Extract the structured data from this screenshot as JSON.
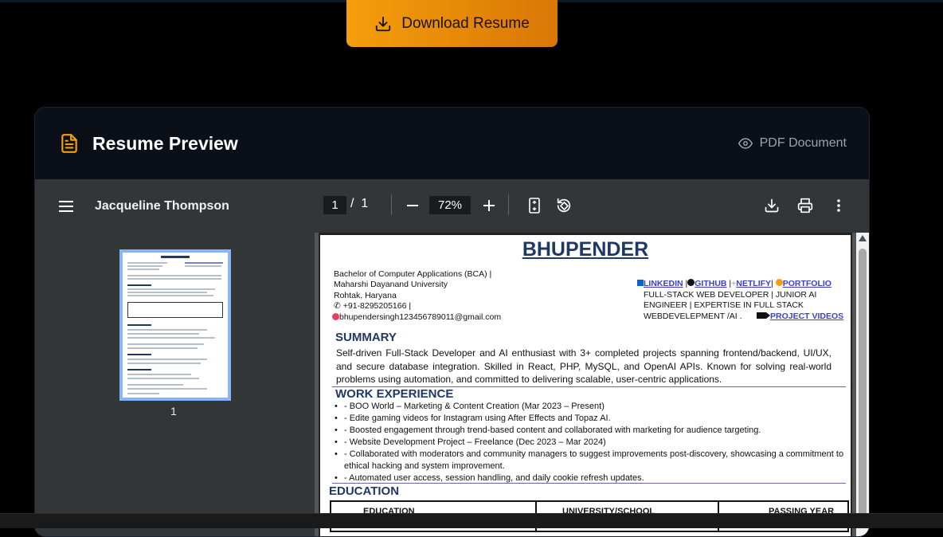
{
  "download_button": {
    "label": "Download Resume",
    "icon": "download-icon"
  },
  "card": {
    "title": "Resume Preview",
    "title_icon": "document-icon",
    "pdf_label": "PDF Document",
    "pdf_icon": "eye-icon"
  },
  "viewer": {
    "doc_name": "Jacqueline Thompson",
    "current_page": "1",
    "page_sep": "/",
    "total_pages": "1",
    "zoom": "72%",
    "thumbnail_page": "1"
  },
  "resume": {
    "name": "BHUPENDER",
    "left_info": [
      "Bachelor of Computer Applications (BCA)  |",
      "Maharshi Dayanand University",
      "Rohtak, Haryana",
      "+91-8295205166 |",
      "bhupendersingh123456789011@gmail.com"
    ],
    "links": [
      "LINKEDIN",
      "GITHUB",
      "NETLIFY",
      "PORTFOLIO"
    ],
    "right_lines": [
      "FULL-STACK WEB DEVELOPER | JUNIOR AI",
      "ENGINEER | EXPERTISE IN FULL STACK",
      "WEBDEVELEPMENT /AI ."
    ],
    "project_videos": "PROJECT VIDEOS",
    "summary_heading": "SUMMARY",
    "summary": "Self-driven Full-Stack Developer and AI enthusiast with 3+ completed projects spanning frontend/backend, UI/UX, and secure database integration. Skilled in React, PHP, MySQL, and OpenAI APIs. Known for solving real-world problems using automation, and committed to delivering scalable, user-centric applications.",
    "work_heading": "WORK EXPERIENCE",
    "work": [
      "- BOO World – Marketing & Content Creation (Mar 2023 – Present)",
      "- Edite gaming videos for Instagram using After Effects and Topaz AI.",
      "- Boosted engagement through trend-based content and collaborated with marketing for audience targeting.",
      "- Website Development Project – Freelance (Dec 2023 – Mar 2024)",
      "- Collaborated with moderators and community managers to suggest improvements post-discovery, showcasing a commitment to ethical hacking and system improvement.",
      "- Automated user access, session handling, and daily cookie refresh updates."
    ],
    "education_heading": "EDUCATION",
    "education_columns": [
      "EDUCATION",
      "UNIVERSITY/SCHOOL",
      "PASSING YEAR"
    ]
  },
  "colors": {
    "accent": "#f59e0b",
    "accent_dark": "#d97706",
    "toolbar": "#323639",
    "viewer_bg": "#525659",
    "resume_heading": "#1f3864",
    "link": "#3b3fcf"
  }
}
